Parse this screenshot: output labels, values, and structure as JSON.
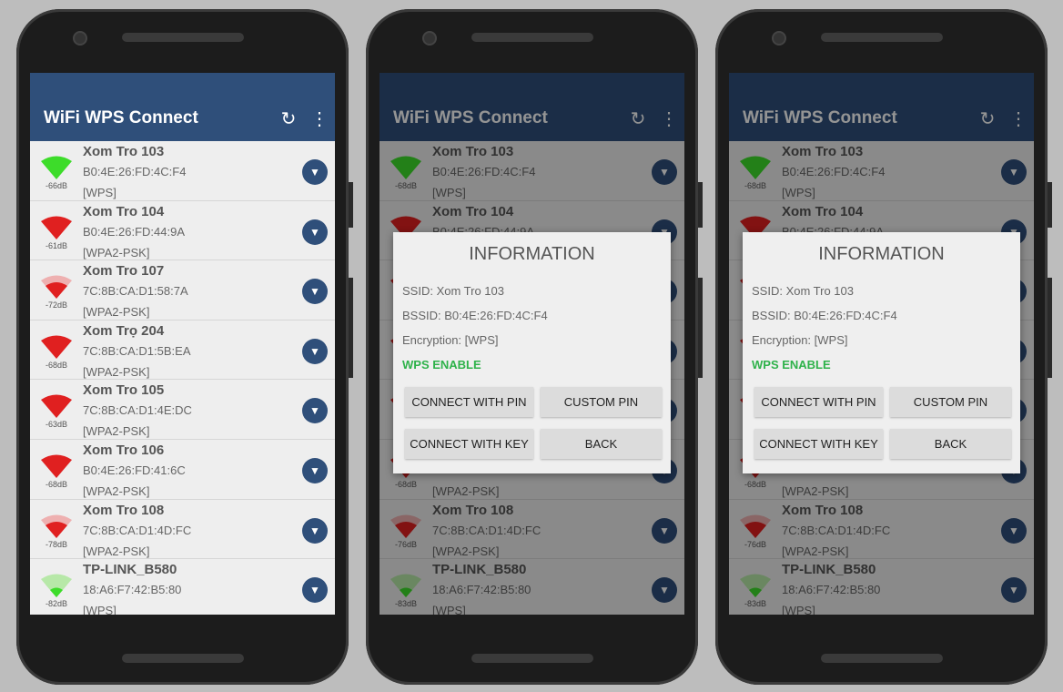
{
  "app": {
    "title": "WiFi WPS Connect",
    "refresh_icon": "refresh-icon",
    "menu_icon": "more-vert-icon",
    "accent": "#2f4f7a"
  },
  "colors": {
    "green": "#3ddc2a",
    "red": "#e02020",
    "wps_enable": "#2eb24a"
  },
  "phones": [
    {
      "dialog": false,
      "networks": [
        {
          "ssid": "Xom Tro 103",
          "bssid": "B0:4E:26:FD:4C:F4",
          "enc": "[WPS]",
          "db": "-66dB",
          "color": "green",
          "level": 3
        },
        {
          "ssid": "Xom Tro 104",
          "bssid": "B0:4E:26:FD:44:9A",
          "enc": "[WPA2-PSK]",
          "db": "-61dB",
          "color": "red",
          "level": 3
        },
        {
          "ssid": "Xom Tro 107",
          "bssid": "7C:8B:CA:D1:58:7A",
          "enc": "[WPA2-PSK]",
          "db": "-72dB",
          "color": "red",
          "level": 2
        },
        {
          "ssid": "Xom Trọ 204",
          "bssid": "7C:8B:CA:D1:5B:EA",
          "enc": "[WPA2-PSK]",
          "db": "-68dB",
          "color": "red",
          "level": 3
        },
        {
          "ssid": "Xom Tro 105",
          "bssid": "7C:8B:CA:D1:4E:DC",
          "enc": "[WPA2-PSK]",
          "db": "-63dB",
          "color": "red",
          "level": 3
        },
        {
          "ssid": "Xom Tro 106",
          "bssid": "B0:4E:26:FD:41:6C",
          "enc": "[WPA2-PSK]",
          "db": "-68dB",
          "color": "red",
          "level": 3
        },
        {
          "ssid": "Xom Tro 108",
          "bssid": "7C:8B:CA:D1:4D:FC",
          "enc": "[WPA2-PSK]",
          "db": "-78dB",
          "color": "red",
          "level": 2
        },
        {
          "ssid": "TP-LINK_B580",
          "bssid": "18:A6:F7:42:B5:80",
          "enc": "[WPS]",
          "db": "-82dB",
          "color": "green",
          "level": 1
        }
      ]
    },
    {
      "dialog": true,
      "networks": [
        {
          "ssid": "Xom Tro 103",
          "bssid": "B0:4E:26:FD:4C:F4",
          "enc": "[WPS]",
          "db": "-68dB",
          "color": "green",
          "level": 3
        },
        {
          "ssid": "Xom Tro 104",
          "bssid": "B0:4E:26:FD:44:9A",
          "enc": "[WPA2-PSK]",
          "db": "",
          "color": "red",
          "level": 3
        },
        {
          "ssid": "",
          "bssid": "",
          "enc": "",
          "db": "",
          "color": "red",
          "level": 3
        },
        {
          "ssid": "",
          "bssid": "",
          "enc": "",
          "db": "",
          "color": "red",
          "level": 3
        },
        {
          "ssid": "",
          "bssid": "",
          "enc": "",
          "db": "",
          "color": "red",
          "level": 3
        },
        {
          "ssid": "",
          "bssid": "",
          "enc": "[WPA2-PSK]",
          "db": "-68dB",
          "color": "red",
          "level": 3
        },
        {
          "ssid": "Xom Tro 108",
          "bssid": "7C:8B:CA:D1:4D:FC",
          "enc": "[WPA2-PSK]",
          "db": "-76dB",
          "color": "red",
          "level": 2
        },
        {
          "ssid": "TP-LINK_B580",
          "bssid": "18:A6:F7:42:B5:80",
          "enc": "[WPS]",
          "db": "-83dB",
          "color": "green",
          "level": 1
        }
      ]
    },
    {
      "dialog": true,
      "networks": [
        {
          "ssid": "Xom Tro 103",
          "bssid": "B0:4E:26:FD:4C:F4",
          "enc": "[WPS]",
          "db": "-68dB",
          "color": "green",
          "level": 3
        },
        {
          "ssid": "Xom Tro 104",
          "bssid": "B0:4E:26:FD:44:9A",
          "enc": "[WPA2-PSK]",
          "db": "",
          "color": "red",
          "level": 3
        },
        {
          "ssid": "",
          "bssid": "",
          "enc": "",
          "db": "",
          "color": "red",
          "level": 3
        },
        {
          "ssid": "",
          "bssid": "",
          "enc": "",
          "db": "",
          "color": "red",
          "level": 3
        },
        {
          "ssid": "",
          "bssid": "",
          "enc": "",
          "db": "",
          "color": "red",
          "level": 3
        },
        {
          "ssid": "",
          "bssid": "",
          "enc": "[WPA2-PSK]",
          "db": "-68dB",
          "color": "red",
          "level": 3
        },
        {
          "ssid": "Xom Tro 108",
          "bssid": "7C:8B:CA:D1:4D:FC",
          "enc": "[WPA2-PSK]",
          "db": "-76dB",
          "color": "red",
          "level": 2
        },
        {
          "ssid": "TP-LINK_B580",
          "bssid": "18:A6:F7:42:B5:80",
          "enc": "[WPS]",
          "db": "-83dB",
          "color": "green",
          "level": 1
        }
      ]
    }
  ],
  "dialog": {
    "title": "INFORMATION",
    "ssid": "SSID: Xom Tro 103",
    "bssid": "BSSID: B0:4E:26:FD:4C:F4",
    "encryption": "Encryption: [WPS]",
    "status": "WPS ENABLE",
    "buttons": {
      "connect_pin": "CONNECT WITH PIN",
      "custom_pin": "CUSTOM PIN",
      "connect_key": "CONNECT WITH KEY",
      "back": "BACK"
    }
  }
}
